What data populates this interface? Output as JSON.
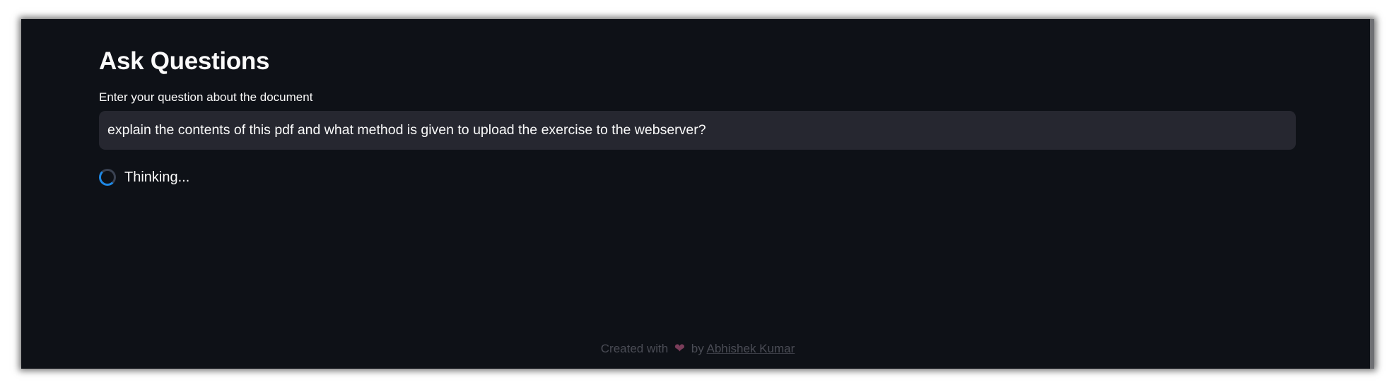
{
  "main": {
    "title": "Ask Questions",
    "input_label": "Enter your question about the document",
    "question_value": "explain the contents of this pdf and what method is given to upload the exercise to the webserver?",
    "status_text": "Thinking..."
  },
  "footer": {
    "created_with": "Created with",
    "heart_icon": "❤",
    "by": "by",
    "author": "Abhishek Kumar"
  },
  "colors": {
    "background": "#0e1117",
    "input_background": "#262730",
    "spinner_accent": "#1e88e5",
    "text": "#fafafa"
  }
}
